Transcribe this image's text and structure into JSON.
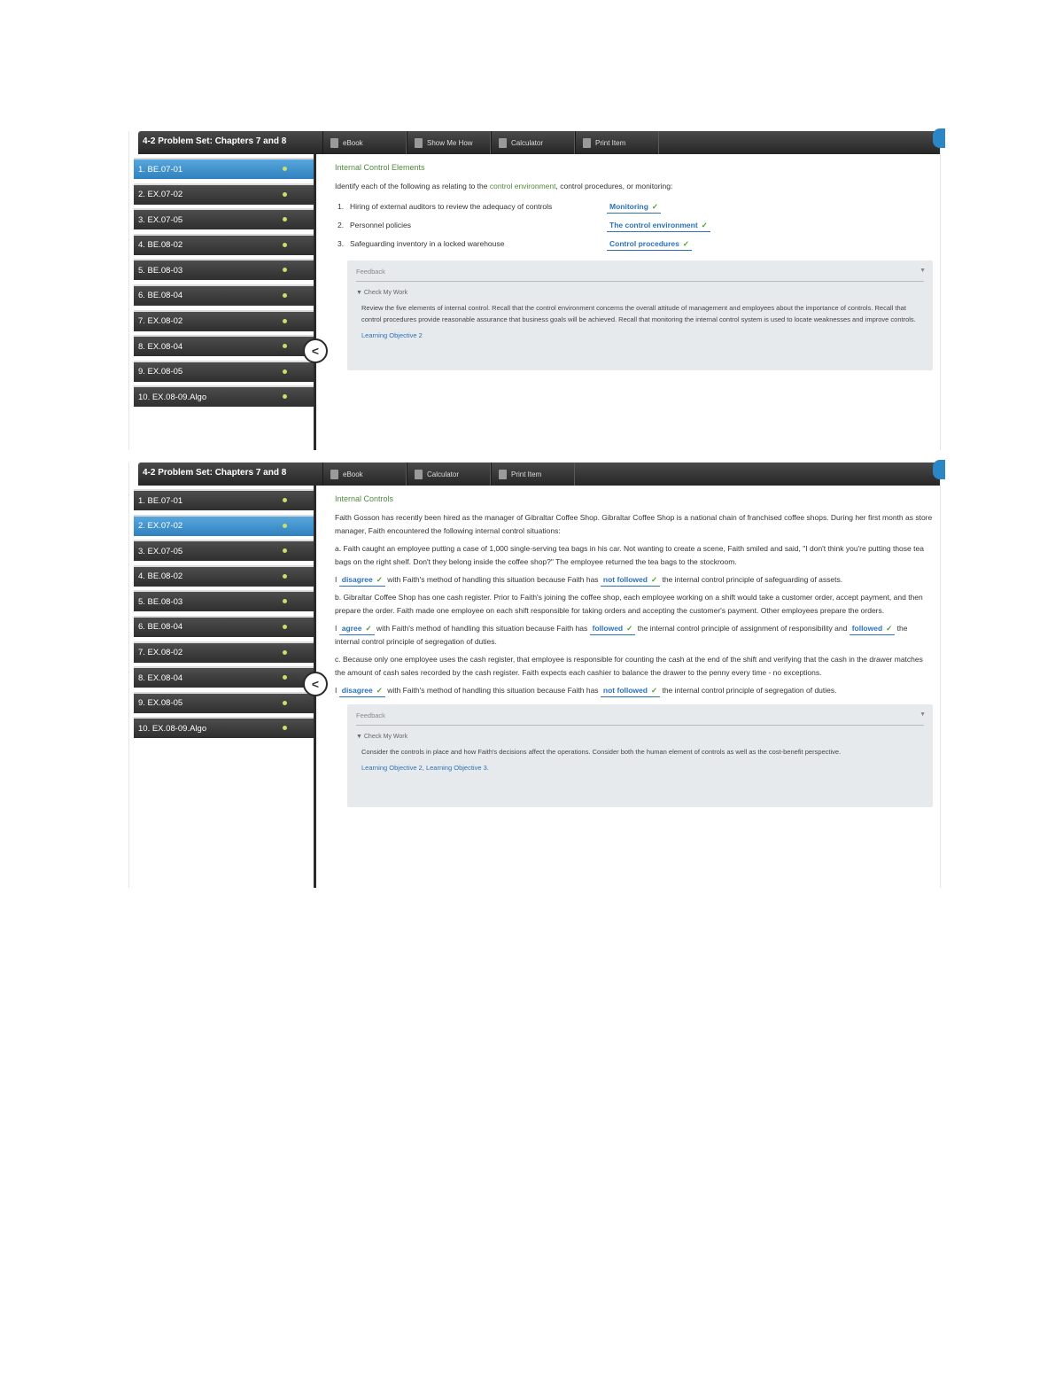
{
  "screen1": {
    "set_title": "4-2 Problem Set: Chapters 7 and 8",
    "tools": [
      {
        "label": "eBook",
        "icon": "book-icon"
      },
      {
        "label": "Show Me How",
        "icon": "video-icon"
      },
      {
        "label": "Calculator",
        "icon": "calculator-icon"
      },
      {
        "label": "Print Item",
        "icon": "print-icon"
      }
    ],
    "questions": [
      "1. BE.07-01",
      "2. EX.07-02",
      "3. EX.07-05",
      "4. BE.08-02",
      "5. BE.08-03",
      "6. BE.08-04",
      "7. EX.08-02",
      "8. EX.08-04",
      "9. EX.08-05",
      "10. EX.08-09.Algo"
    ],
    "active_index": 0,
    "section_title": "Internal Control Elements",
    "prompt_start": "Identify each of the following as relating to the ",
    "prompt_link": "control environment",
    "prompt_end": ", control procedures, or monitoring:",
    "items": [
      {
        "num": "1.",
        "text": "Hiring of external auditors to review the adequacy of controls",
        "answer": "Monitoring"
      },
      {
        "num": "2.",
        "text": "Personnel policies",
        "answer": "The control environment"
      },
      {
        "num": "3.",
        "text": "Safeguarding inventory in a locked warehouse",
        "answer": "Control procedures"
      }
    ],
    "feedback": {
      "title": "Feedback",
      "check_label": "▼ Check My Work",
      "body": "Review the five elements of internal control. Recall that the control environment concerns the overall attitude of management and employees about the importance of controls. Recall that control procedures provide reasonable assurance that business goals will be achieved. Recall that monitoring the internal control system is used to locate weaknesses and improve controls.",
      "link": "Learning Objective 2"
    }
  },
  "screen2": {
    "set_title": "4-2 Problem Set: Chapters 7 and 8",
    "tools": [
      {
        "label": "eBook",
        "icon": "book-icon"
      },
      {
        "label": "Calculator",
        "icon": "calculator-icon"
      },
      {
        "label": "Print Item",
        "icon": "print-icon"
      }
    ],
    "questions": [
      "1. BE.07-01",
      "2. EX.07-02",
      "3. EX.07-05",
      "4. BE.08-02",
      "5. BE.08-03",
      "6. BE.08-04",
      "7. EX.08-02",
      "8. EX.08-04",
      "9. EX.08-05",
      "10. EX.08-09.Algo"
    ],
    "active_index": 1,
    "section_title": "Internal Controls",
    "intro": "Faith Gosson has recently been hired as the manager of Gibraltar Coffee Shop. Gibraltar Coffee Shop is a national chain of franchised coffee shops. During her first month as store manager, Faith encountered the following internal control situations:",
    "a_text": "a.  Faith caught an employee putting a case of 1,000 single-serving tea bags in his car. Not wanting to create a scene, Faith smiled and said, \"I don't think you're putting those tea bags on the right shelf. Don't they belong inside the coffee shop?\" The employee returned the tea bags to the stockroom.",
    "a_ans1": "disagree",
    "a_mid": " with Faith's method of handling this situation because Faith has ",
    "a_ans2": "not followed",
    "a_end": " the internal control principle of safeguarding of assets.",
    "b_text": "b.  Gibraltar Coffee Shop has one cash register. Prior to Faith's joining the coffee shop, each employee working on a shift would take a customer order, accept payment, and then prepare the order. Faith made one employee on each shift responsible for taking orders and accepting the customer's payment. Other employees prepare the orders.",
    "b_ans1": "agree",
    "b_mid": " with Faith's method of handling this situation because Faith has ",
    "b_ans2": "followed",
    "b_mid2": " the internal control principle of assignment of responsibility and ",
    "b_ans3": "followed",
    "b_end": " the internal control principle of segregation of duties.",
    "c_text": "c.  Because only one employee uses the cash register, that employee is responsible for counting the cash at the end of the shift and verifying that the cash in the drawer matches the amount of cash sales recorded by the cash register. Faith expects each cashier to balance the drawer to the penny every time - no exceptions.",
    "c_ans1": "disagree",
    "c_mid": " with Faith's method of handling this situation because Faith has ",
    "c_ans2": "not followed",
    "c_end": " the internal control principle of segregation of duties.",
    "pronoun": "I",
    "feedback": {
      "title": "Feedback",
      "check_label": "▼ Check My Work",
      "body": "Consider the controls in place and how Faith's decisions affect the operations. Consider both the human element of controls as well as the cost-benefit perspective.",
      "link": "Learning Objective 2, Learning Objective 3."
    }
  },
  "colors": {
    "accent_blue": "#2b72b7",
    "active_tab": "#3f95d1",
    "correct_green": "#4e9a2e",
    "title_green": "#4e8a3c"
  }
}
